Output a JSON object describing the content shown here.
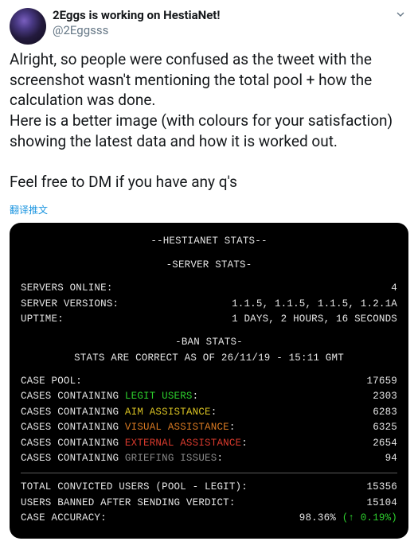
{
  "tweet": {
    "display_name": "2Eggs is working on HestiaNet!",
    "handle": "@2Eggsss",
    "body": "Alright, so people were confused as the tweet with the screenshot wasn't mentioning the total pool + how the calculation was done.\nHere is a better image (with colours for your satisfaction) showing the latest data and how it is worked out.\n\nFeel free to DM if you have any q's",
    "translate": "翻译推文"
  },
  "terminal": {
    "title": "--HESTIANET STATS--",
    "server_header": "-SERVER STATS-",
    "servers_online_label": "SERVERS ONLINE:",
    "servers_online_value": "4",
    "server_versions_label": "SERVER VERSIONS:",
    "server_versions_value": "1.1.5, 1.1.5, 1.1.5, 1.2.1A",
    "uptime_label": "UPTIME:",
    "uptime_value": "1 DAYS, 2 HOURS, 16 SECONDS",
    "ban_header": "-BAN STATS-",
    "ban_sub": "STATS ARE CORRECT AS OF 26/11/19 - 15:11 GMT",
    "case_pool_label": "CASE POOL:",
    "case_pool_value": "17659",
    "cc_prefix": "CASES CONTAINING ",
    "legit_label": "LEGIT USERS",
    "legit_value": "2303",
    "aim_label": "AIM ASSISTANCE",
    "aim_value": "6283",
    "visual_label": "VISUAL ASSISTANCE",
    "visual_value": "6325",
    "external_label": "EXTERNAL ASSISTANCE",
    "external_value": "2654",
    "griefing_label": "GRIEFING ISSUES",
    "griefing_value": "94",
    "colon": ":",
    "total_convicted_label": "TOTAL CONVICTED USERS (POOL - LEGIT):",
    "total_convicted_value": "15356",
    "users_banned_label": "USERS BANNED AFTER SENDING VERDICT:",
    "users_banned_value": "15104",
    "accuracy_label": "CASE ACCURACY:",
    "accuracy_value": "98.36%",
    "accuracy_delta": "(↑ 0.19%)"
  }
}
